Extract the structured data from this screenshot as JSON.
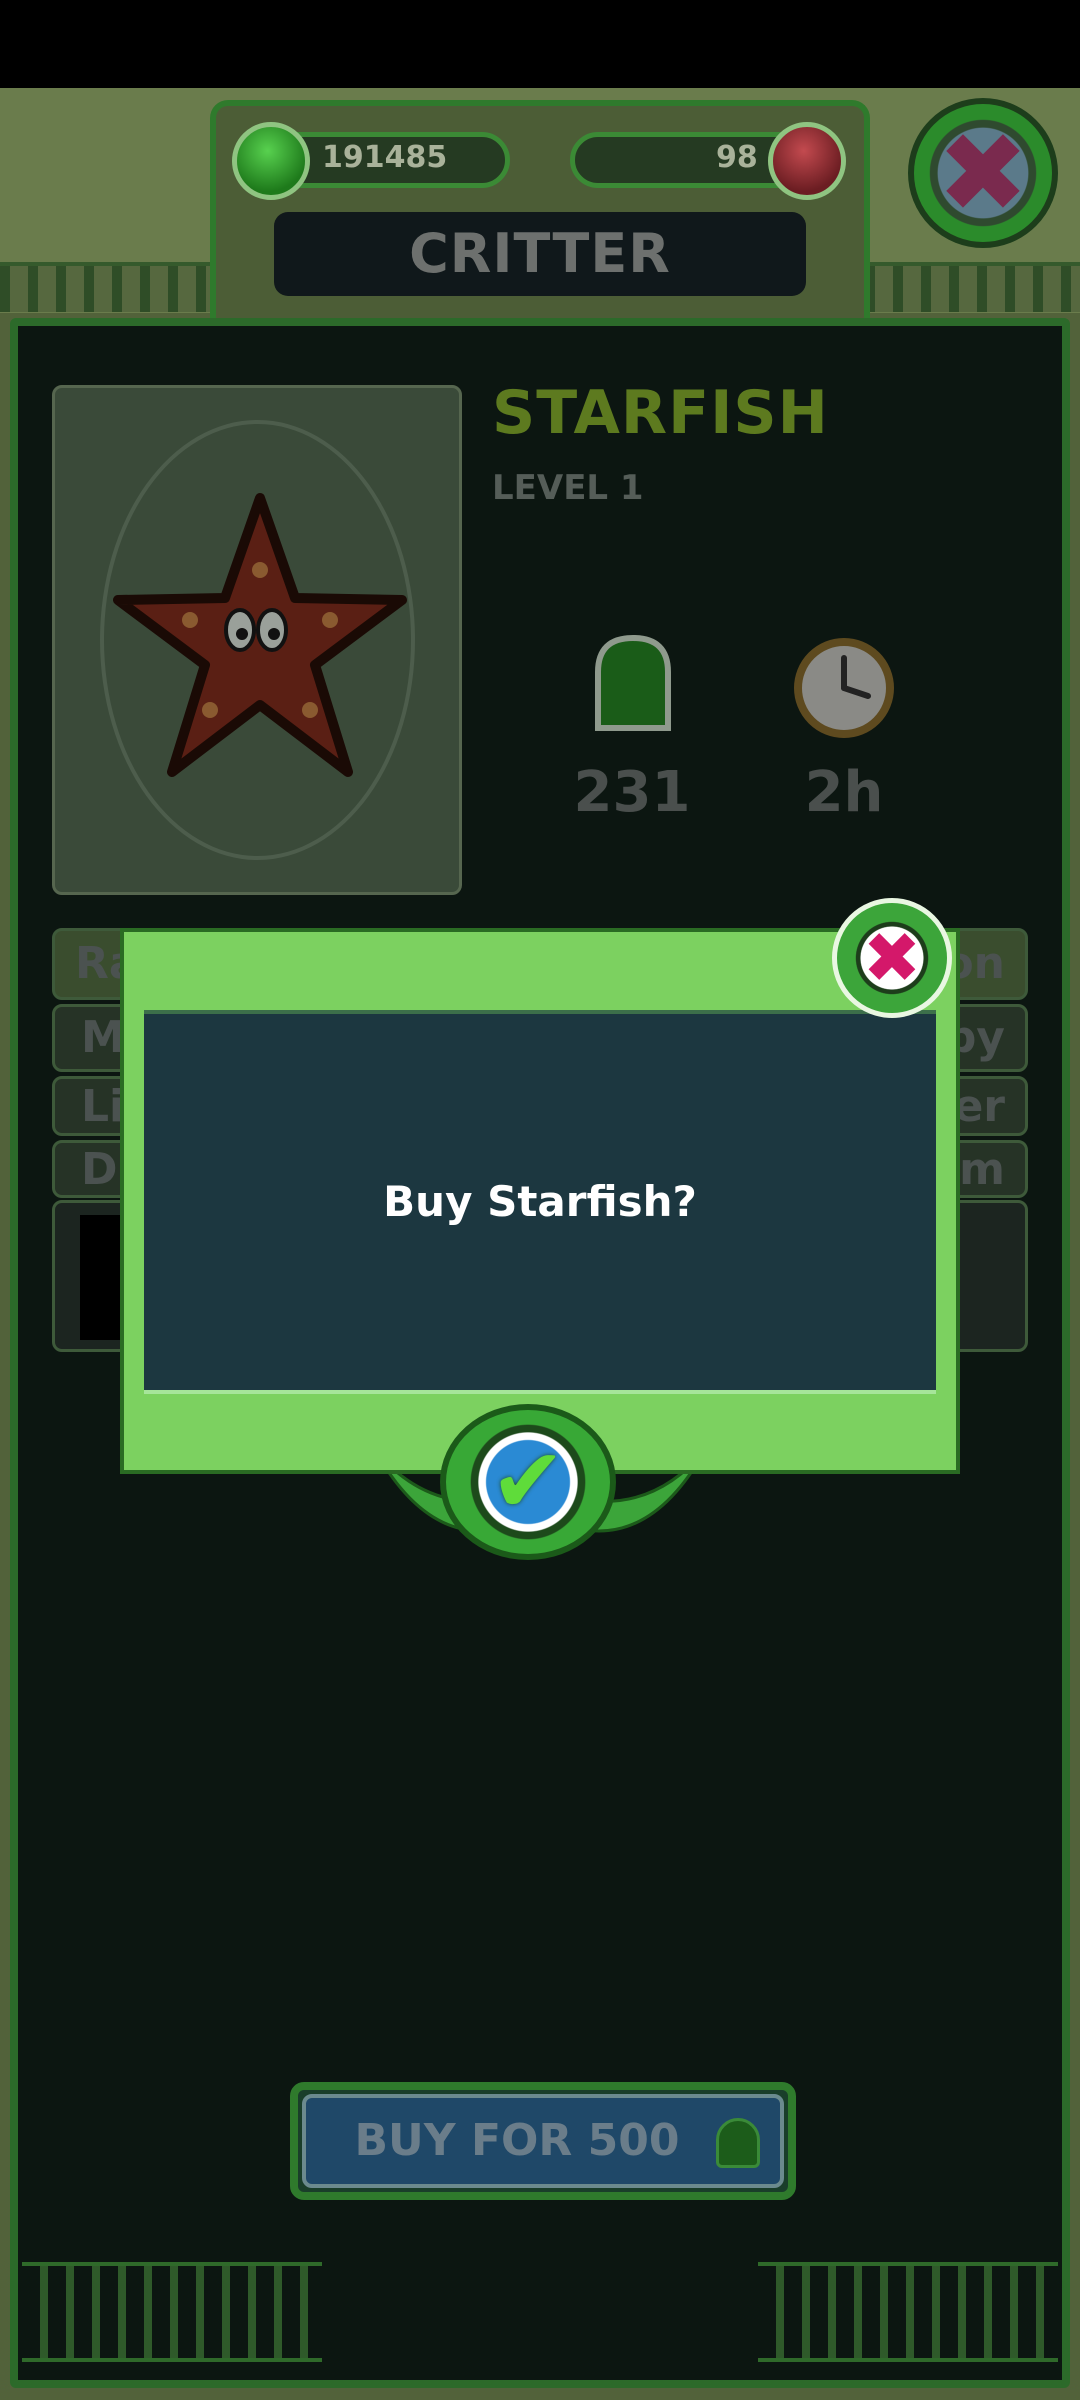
{
  "header": {
    "title": "CRITTER",
    "green_currency": "191485",
    "red_currency": "98"
  },
  "critter": {
    "name": "STARFISH",
    "level": "LEVEL 1",
    "gem_cost": "231",
    "duration": "2h"
  },
  "info_rows": [
    {
      "left": "Ra",
      "right": "on"
    },
    {
      "left": "M",
      "right": "py"
    },
    {
      "left": "Li",
      "right": "er"
    },
    {
      "left": "Di",
      "right": "m"
    }
  ],
  "buy_button": {
    "label": "BUY FOR 500"
  },
  "dialog": {
    "message": "Buy Starfish?"
  },
  "icons": {
    "close": "close-icon",
    "confirm": "checkmark-icon",
    "green_gem": "green-gem-icon",
    "red_gem": "red-crystal-icon",
    "clock": "clock-icon",
    "starfish": "starfish-image"
  },
  "colors": {
    "dialog_green": "#7cd160",
    "dialog_body": "#1c3740",
    "title_green": "#5d7a1f",
    "close_x": "#d4186a",
    "confirm_blue": "#2a8ad4"
  }
}
